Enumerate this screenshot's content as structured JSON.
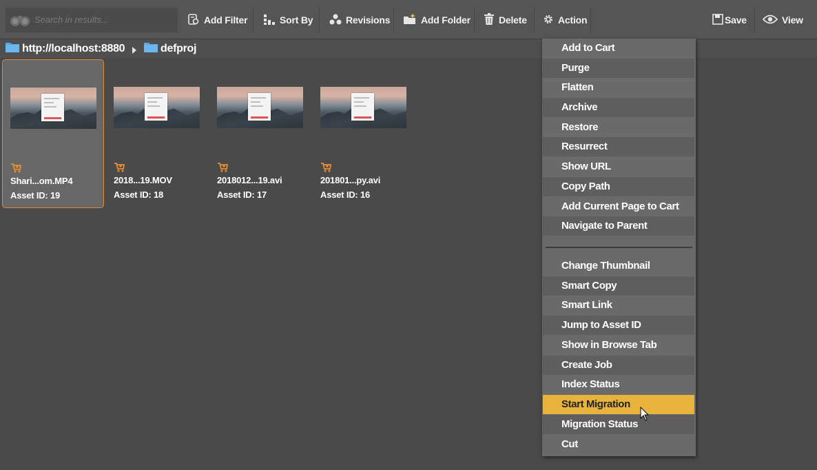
{
  "toolbar": {
    "search_placeholder": "Search in results...",
    "add_filter": "Add Filter",
    "sort_by": "Sort By",
    "revisions": "Revisions",
    "add_folder": "Add Folder",
    "delete": "Delete",
    "action": "Action",
    "save": "Save",
    "view": "View"
  },
  "breadcrumb": {
    "root": "http://localhost:8880",
    "folder": "defproj"
  },
  "assets": [
    {
      "name": "Shari...om.MP4",
      "id_label": "Asset ID: 19",
      "selected": true
    },
    {
      "name": "2018...19.MOV",
      "id_label": "Asset ID: 18",
      "selected": false
    },
    {
      "name": "2018012...19.avi",
      "id_label": "Asset ID: 17",
      "selected": false
    },
    {
      "name": "201801...py.avi",
      "id_label": "Asset ID: 16",
      "selected": false
    }
  ],
  "action_menu": {
    "group1": [
      "Add to Cart",
      "Purge",
      "Flatten",
      "Archive",
      "Restore",
      "Resurrect",
      "Show URL",
      "Copy Path",
      "Add Current Page to Cart",
      "Navigate to Parent"
    ],
    "group2": [
      "Change Thumbnail",
      "Smart Copy",
      "Smart Link",
      "Jump to Asset ID",
      "Show in Browse Tab",
      "Create Job",
      "Index Status",
      "Start Migration",
      "Migration Status",
      "Cut"
    ],
    "highlighted": "Start Migration"
  },
  "colors": {
    "background": "#4a4a4a",
    "toolbar": "#555555",
    "menu": "#6a6a6a",
    "highlight": "#e8b33d",
    "selection_border": "#e08a2e",
    "folder_icon": "#5aa7e0",
    "cart_icon": "#e8902c"
  }
}
